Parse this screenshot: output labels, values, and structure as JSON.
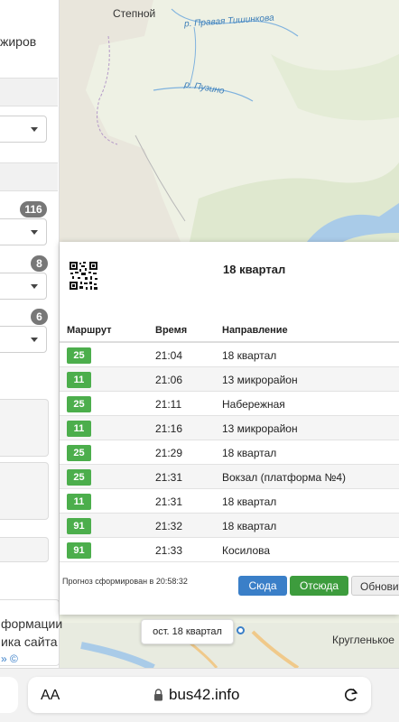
{
  "map": {
    "place_labels": {
      "stepnoy": "Степной",
      "krugleny": "Кругленькое"
    },
    "river_labels": {
      "pravaya_tishinkova": "р. Правая Тишинкова",
      "puzino": "р. Пузино"
    },
    "marker": {
      "label": "ост. 18 квартал"
    }
  },
  "sidebar": {
    "title_fragment": "жиров",
    "badges": [
      "116",
      "8",
      "6"
    ],
    "info_lines": [
      "формации",
      "ика сайта",
      "» ©"
    ]
  },
  "popup": {
    "stop_title": "18 квартал",
    "columns": {
      "route": "Маршрут",
      "time": "Время",
      "direction": "Направление"
    },
    "rows": [
      {
        "route": "25",
        "time": "21:04",
        "direction": "18 квартал"
      },
      {
        "route": "11",
        "time": "21:06",
        "direction": "13 микрорайон"
      },
      {
        "route": "25",
        "time": "21:11",
        "direction": "Набережная"
      },
      {
        "route": "11",
        "time": "21:16",
        "direction": "13 микрорайон"
      },
      {
        "route": "25",
        "time": "21:29",
        "direction": "18 квартал"
      },
      {
        "route": "25",
        "time": "21:31",
        "direction": "Вокзал (платформа №4)"
      },
      {
        "route": "11",
        "time": "21:31",
        "direction": "18 квартал"
      },
      {
        "route": "91",
        "time": "21:32",
        "direction": "18 квартал"
      },
      {
        "route": "91",
        "time": "21:33",
        "direction": "Косилова"
      }
    ],
    "forecast": "Прогноз сформирован в 20:58:32",
    "buttons": {
      "here": "Сюда",
      "from_here": "Отсюда",
      "refresh": "Обновить"
    }
  },
  "browser": {
    "text_size": "AA",
    "url": "bus42.info",
    "lock_icon": "lock-icon",
    "reload_icon": "reload-icon"
  },
  "colors": {
    "route_badge": "#4cae4c",
    "button_blue": "#3a7fc8",
    "button_green": "#3d9c3d"
  }
}
